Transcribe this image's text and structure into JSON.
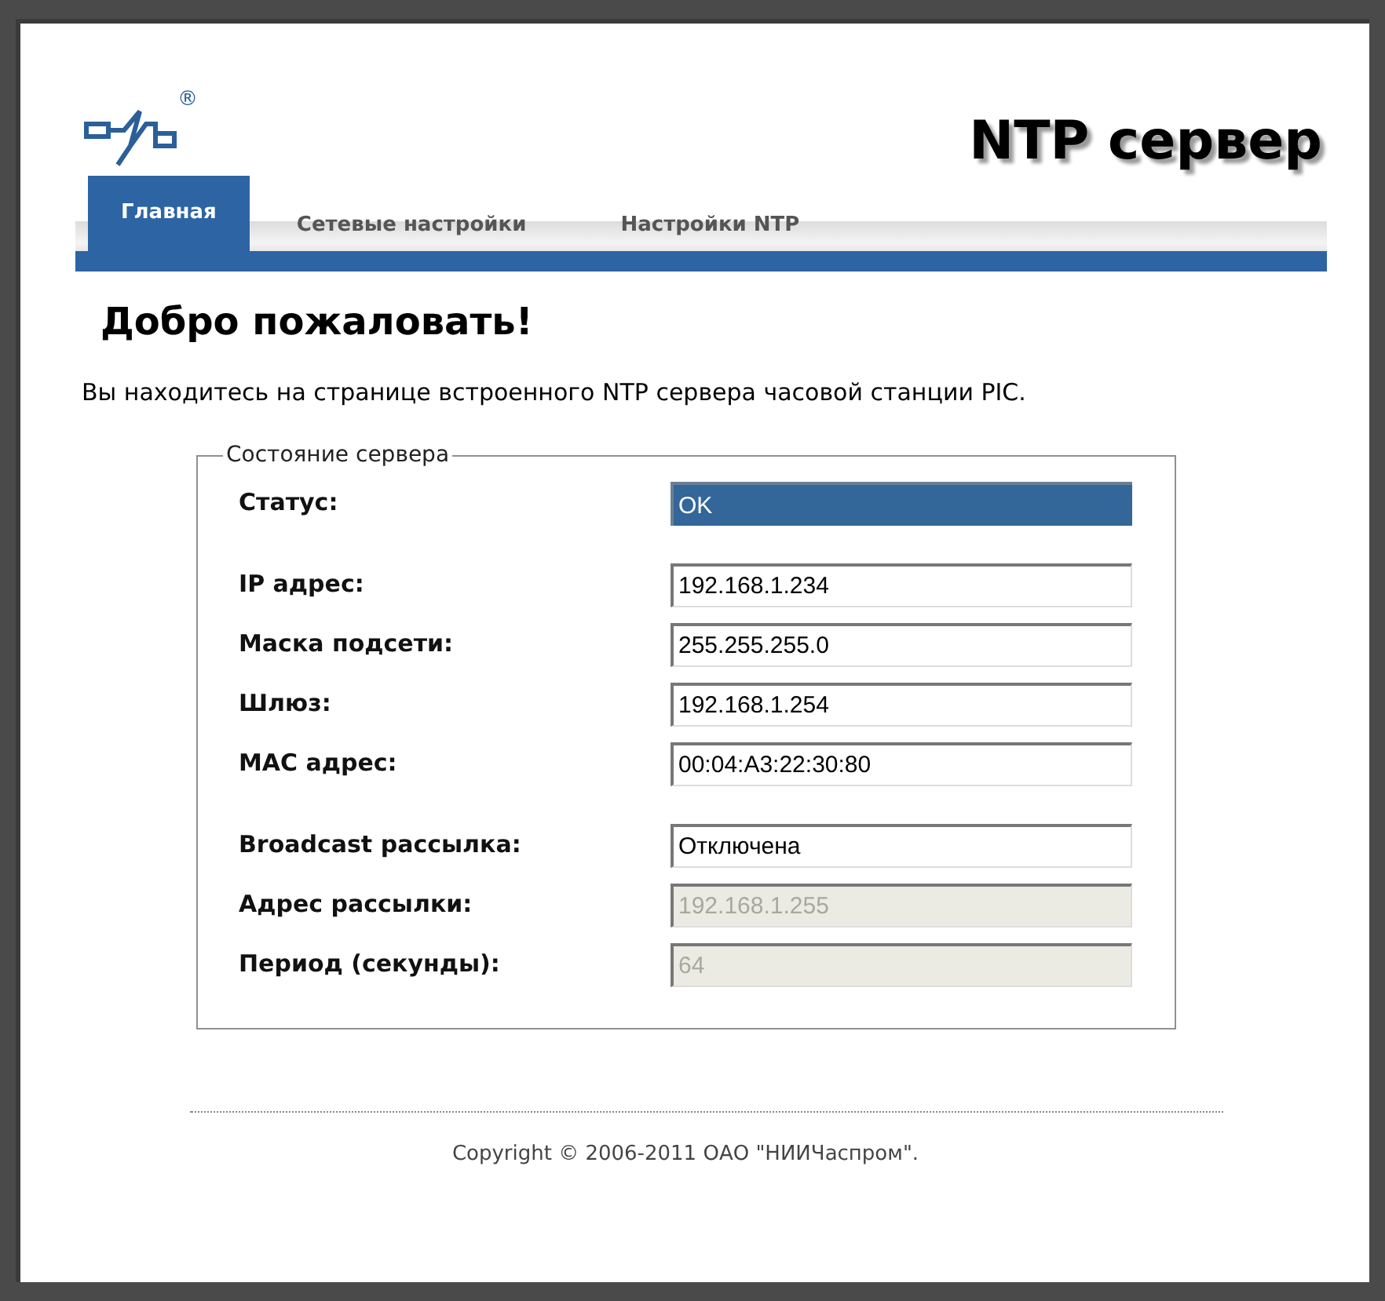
{
  "header": {
    "logo_mark": "®",
    "title": "NTP сервер"
  },
  "tabs": [
    {
      "label": "Главная",
      "selected": true
    },
    {
      "label": "Сетевые настройки",
      "selected": false
    },
    {
      "label": "Настройки NTP",
      "selected": false
    }
  ],
  "heading": "Добро пожаловать!",
  "intro": "Вы находитесь на странице встроенного NTP сервера часовой станции PIC.",
  "panel": {
    "legend": "Состояние сервера",
    "groups": [
      [
        {
          "label": "Статус:",
          "value": "OK",
          "kind": "status"
        }
      ],
      [
        {
          "label": "IP адрес:",
          "value": "192.168.1.234",
          "kind": "input",
          "disabled": false
        },
        {
          "label": "Маска подсети:",
          "value": "255.255.255.0",
          "kind": "input",
          "disabled": false
        },
        {
          "label": "Шлюз:",
          "value": "192.168.1.254",
          "kind": "input",
          "disabled": false
        },
        {
          "label": "MAC адрес:",
          "value": "00:04:A3:22:30:80",
          "kind": "input",
          "disabled": false
        }
      ],
      [
        {
          "label": "Broadcast рассылка:",
          "value": "Отключена",
          "kind": "input",
          "disabled": false
        },
        {
          "label": "Адрес рассылки:",
          "value": "192.168.1.255",
          "kind": "input",
          "disabled": true
        },
        {
          "label": "Период (секунды):",
          "value": "64",
          "kind": "input",
          "disabled": true
        }
      ]
    ]
  },
  "footer": "Copyright © 2006-2011 ОАО \"НИИЧаспром\"."
}
